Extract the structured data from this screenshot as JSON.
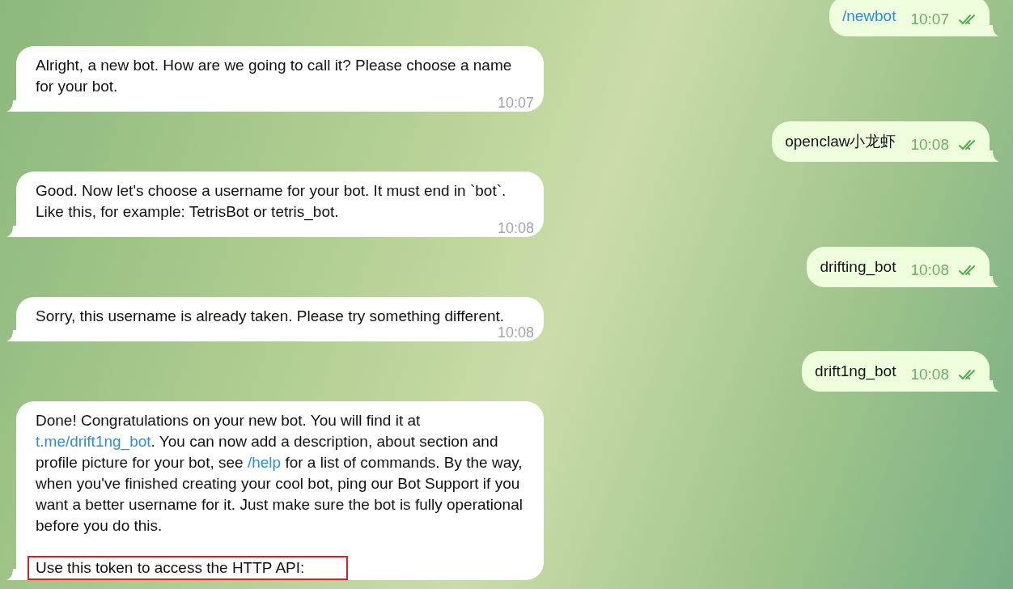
{
  "messages": [
    {
      "kind": "outgoing",
      "command": true,
      "text": "/newbot",
      "time": "10:07",
      "read": true
    },
    {
      "kind": "incoming",
      "time": "10:07",
      "paragraphs": [
        {
          "highlighted": false,
          "segments": [
            {
              "kind": "text",
              "text": "Alright, a new bot. How are we going to call it? Please choose a name for your bot."
            }
          ]
        }
      ]
    },
    {
      "kind": "outgoing",
      "command": false,
      "text": "openclaw小龙虾",
      "time": "10:08",
      "read": true
    },
    {
      "kind": "incoming",
      "time": "10:08",
      "paragraphs": [
        {
          "highlighted": false,
          "segments": [
            {
              "kind": "text",
              "text": "Good. Now let's choose a username for your bot. It must end in `bot`. Like this, for example: TetrisBot or tetris_bot."
            }
          ]
        }
      ]
    },
    {
      "kind": "outgoing",
      "command": false,
      "text": "drifting_bot",
      "time": "10:08",
      "read": true
    },
    {
      "kind": "incoming",
      "time": "10:08",
      "paragraphs": [
        {
          "highlighted": false,
          "segments": [
            {
              "kind": "text",
              "text": "Sorry, this username is already taken. Please try something different."
            }
          ]
        }
      ]
    },
    {
      "kind": "outgoing",
      "command": false,
      "text": "drift1ng_bot",
      "time": "10:08",
      "read": true
    },
    {
      "kind": "incoming",
      "paragraphs": [
        {
          "highlighted": false,
          "segments": [
            {
              "kind": "text",
              "text": "Done! Congratulations on your new bot. You will find it at "
            },
            {
              "kind": "link",
              "text": "t.me/drift1ng_bot"
            },
            {
              "kind": "text",
              "text": ". You can now add a description, about section and profile picture for your bot, see "
            },
            {
              "kind": "link",
              "text": "/help"
            },
            {
              "kind": "text",
              "text": " for a list of commands. By the way, when you've finished creating your cool bot, ping our Bot Support if you want a better username for it. Just make sure the bot is fully operational before you do this."
            }
          ]
        },
        {
          "highlighted": true,
          "segments": [
            {
              "kind": "text",
              "text": "Use this token to access the HTTP API:"
            }
          ]
        }
      ]
    }
  ]
}
